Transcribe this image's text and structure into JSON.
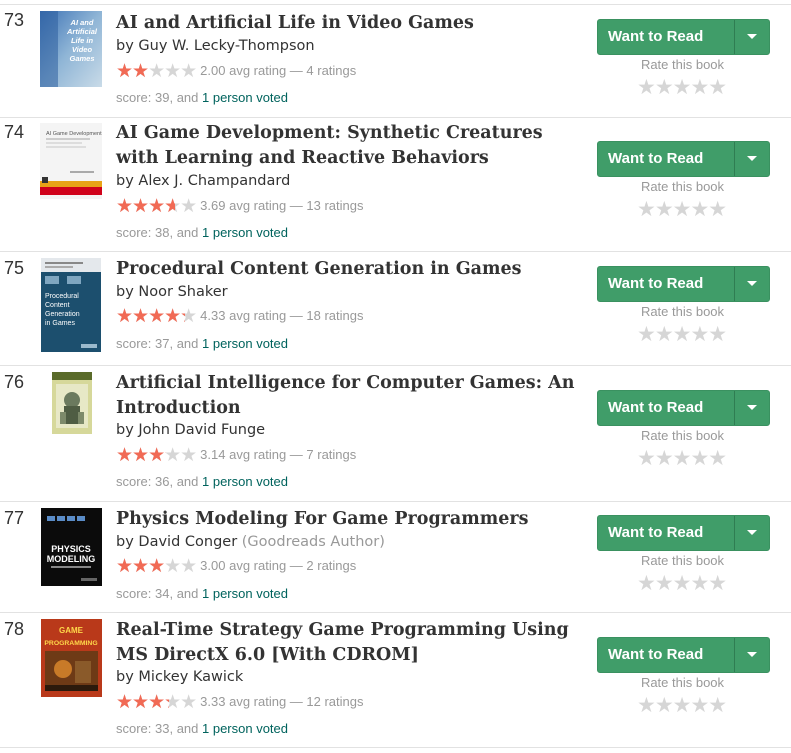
{
  "books": [
    {
      "rank": "73",
      "title": "AI and Artificial Life in Video Games",
      "author": "Guy W. Lecky-Thompson",
      "author_role": "",
      "rating": 2.0,
      "rating_text": "2.00 avg rating — 4 ratings",
      "score_prefix": "score: 39, and ",
      "voted": "1 person voted",
      "cover_text": "AI and Artificial Life in Video Games"
    },
    {
      "rank": "74",
      "title": "AI Game Development: Synthetic Creatures with Learning and Reactive Behaviors",
      "author": "Alex J. Champandard",
      "author_role": "",
      "rating": 3.69,
      "rating_text": "3.69 avg rating — 13 ratings",
      "score_prefix": "score: 38, and ",
      "voted": "1 person voted",
      "cover_text": "AI Game Development"
    },
    {
      "rank": "75",
      "title": "Procedural Content Generation in Games",
      "author": "Noor Shaker",
      "author_role": "",
      "rating": 4.33,
      "rating_text": "4.33 avg rating — 18 ratings",
      "score_prefix": "score: 37, and ",
      "voted": "1 person voted",
      "cover_text": "Procedural Content Generation in Games"
    },
    {
      "rank": "76",
      "title": "Artificial Intelligence for Computer Games: An Introduction",
      "author": "John David Funge",
      "author_role": "",
      "rating": 3.14,
      "rating_text": "3.14 avg rating — 7 ratings",
      "score_prefix": "score: 36, and ",
      "voted": "1 person voted",
      "cover_text": ""
    },
    {
      "rank": "77",
      "title": "Physics Modeling For Game Programmers",
      "author": "David Conger",
      "author_role": "(Goodreads Author)",
      "rating": 3.0,
      "rating_text": "3.00 avg rating — 2 ratings",
      "score_prefix": "score: 34, and ",
      "voted": "1 person voted",
      "cover_text": "PHYSICS MODELING"
    },
    {
      "rank": "78",
      "title": "Real-Time Strategy Game Programming Using MS DirectX 6.0 [With CDROM]",
      "author": "Mickey Kawick",
      "author_role": "",
      "rating": 3.33,
      "rating_text": "3.33 avg rating — 12 ratings",
      "score_prefix": "score: 33, and ",
      "voted": "1 person voted",
      "cover_text": "GAME PROGRAMMING"
    }
  ],
  "ui": {
    "want_to_read_label": "Want to Read",
    "rate_label": "Rate this book",
    "shelf_menu_icon": "chevron-down-icon",
    "star_icon": "star-icon"
  },
  "colors": {
    "button": "#409d69",
    "star_filled": "#f16a55",
    "star_empty": "#d6d6d6",
    "link": "#00635d"
  }
}
